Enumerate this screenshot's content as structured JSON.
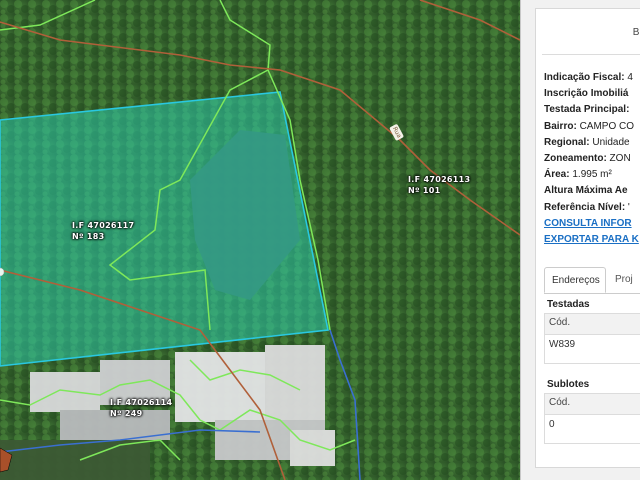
{
  "map": {
    "lots": [
      {
        "if": "I.F 47026117",
        "num": "Nº 183"
      },
      {
        "if": "I.F 47026113",
        "num": "Nº 101"
      },
      {
        "if": "I.F 47026114",
        "num": "Nº 249"
      }
    ],
    "road_label": "Rua",
    "colors": {
      "selected_fill": "#2ec9a8",
      "selected_outline": "#29c8e0",
      "lot_lines": "#7ee85a",
      "road": "#b0603a",
      "water": "#3a6fd1"
    }
  },
  "panel": {
    "title": "Bus",
    "fields": [
      {
        "label": "Indicação Fiscal:",
        "value": " 4"
      },
      {
        "label": "Inscrição Imobiliá",
        "value": ""
      },
      {
        "label": "Testada Principal:",
        "value": ""
      },
      {
        "label": "Bairro:",
        "value": " CAMPO CO"
      },
      {
        "label": "Regional:",
        "value": " Unidade"
      },
      {
        "label": "Zoneamento:",
        "value": " ZON"
      },
      {
        "label": "Área:",
        "value": " 1.995 m²"
      },
      {
        "label": "Altura Máxima Ae",
        "value": ""
      },
      {
        "label": "Referência Nível:",
        "value": " '"
      }
    ],
    "links": [
      "CONSULTA INFOR",
      "EXPORTAR PARA K"
    ],
    "tabs": [
      "Endereços",
      "Proj"
    ],
    "testadas": {
      "title": "Testadas",
      "header": "Cód.",
      "value": "W839"
    },
    "sublotes": {
      "title": "Sublotes",
      "header": "Cód.",
      "value": "0"
    }
  }
}
